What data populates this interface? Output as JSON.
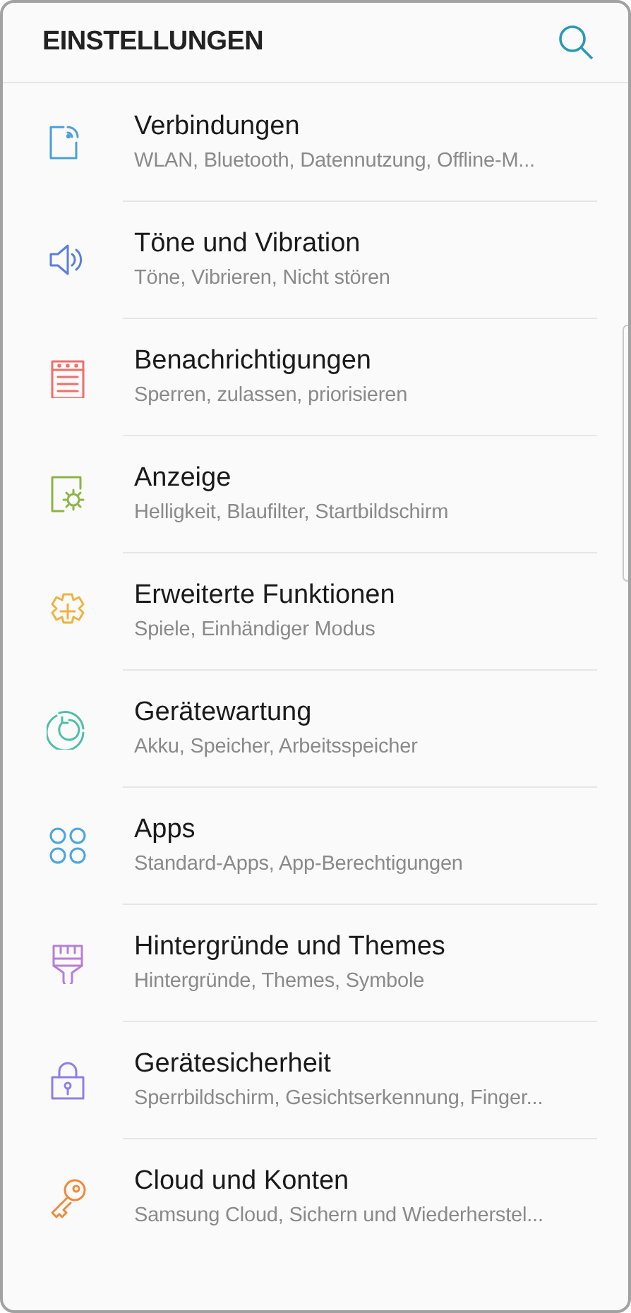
{
  "header": {
    "title": "EINSTELLUNGEN"
  },
  "items": [
    {
      "title": "Verbindungen",
      "subtitle": "WLAN, Bluetooth, Datennutzung, Offline-M...",
      "color": "#4a9fd8"
    },
    {
      "title": "Töne und Vibration",
      "subtitle": "Töne, Vibrieren, Nicht stören",
      "color": "#5b7fe0"
    },
    {
      "title": "Benachrichtigungen",
      "subtitle": "Sperren, zulassen, priorisieren",
      "color": "#ef6f6a"
    },
    {
      "title": "Anzeige",
      "subtitle": "Helligkeit, Blaufilter, Startbildschirm",
      "color": "#8db446"
    },
    {
      "title": "Erweiterte Funktionen",
      "subtitle": "Spiele, Einhändiger Modus",
      "color": "#efb240"
    },
    {
      "title": "Gerätewartung",
      "subtitle": "Akku, Speicher, Arbeitsspeicher",
      "color": "#4fbfa5"
    },
    {
      "title": "Apps",
      "subtitle": "Standard-Apps, App-Berechtigungen",
      "color": "#4aa6e0"
    },
    {
      "title": "Hintergründe und Themes",
      "subtitle": "Hintergründe, Themes, Symbole",
      "color": "#b77fd6"
    },
    {
      "title": "Gerätesicherheit",
      "subtitle": "Sperrbildschirm, Gesichtserkennung, Finger...",
      "color": "#8f7fe6"
    },
    {
      "title": "Cloud und Konten",
      "subtitle": "Samsung Cloud, Sichern und Wiederherstel...",
      "color": "#f08a3c"
    }
  ]
}
